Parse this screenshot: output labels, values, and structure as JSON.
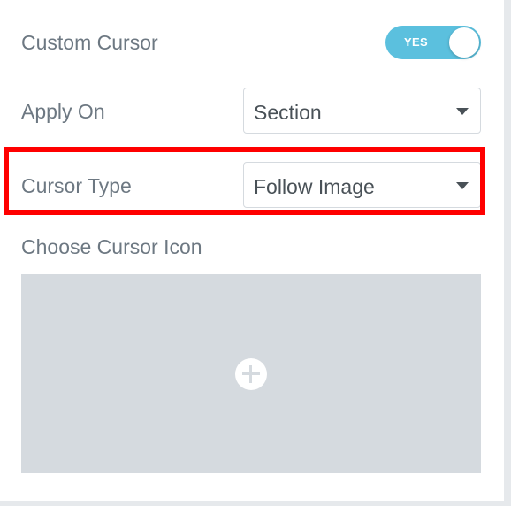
{
  "custom_cursor": {
    "label": "Custom Cursor",
    "toggle_text": "YES",
    "toggle_on": true,
    "toggle_color": "#5bc0de"
  },
  "apply_on": {
    "label": "Apply On",
    "value": "Section"
  },
  "cursor_type": {
    "label": "Cursor Type",
    "value": "Follow Image",
    "highlight_color": "#ff0000"
  },
  "cursor_icon": {
    "label": "Choose Cursor Icon",
    "icon": "plus-circle-icon"
  }
}
